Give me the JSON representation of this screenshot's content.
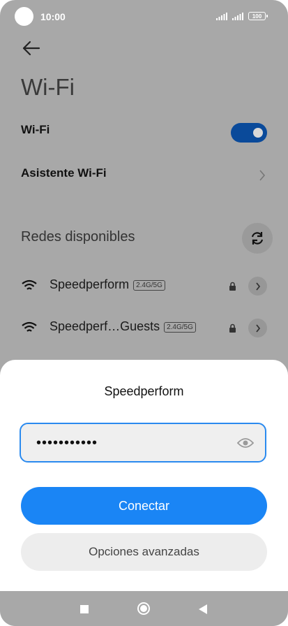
{
  "status_bar": {
    "time": "10:00",
    "battery": "100"
  },
  "page": {
    "title": "Wi-Fi"
  },
  "wifi_toggle": {
    "label": "Wi-Fi",
    "enabled": true
  },
  "assistant": {
    "label": "Asistente Wi-Fi"
  },
  "available": {
    "label": "Redes disponibles"
  },
  "networks": [
    {
      "name": "Speedperform",
      "band": "2.4G/5G",
      "secured": true
    },
    {
      "name": "Speedperf…Guests",
      "band": "2.4G/5G",
      "secured": true
    }
  ],
  "dialog": {
    "title": "Speedperform",
    "password_value": "•••••••••••",
    "connect_label": "Conectar",
    "advanced_label": "Opciones avanzadas"
  },
  "colors": {
    "accent": "#1a85f5",
    "toggle_on": "#0a4a9a",
    "dim_overlay": "#a8a8a8"
  }
}
